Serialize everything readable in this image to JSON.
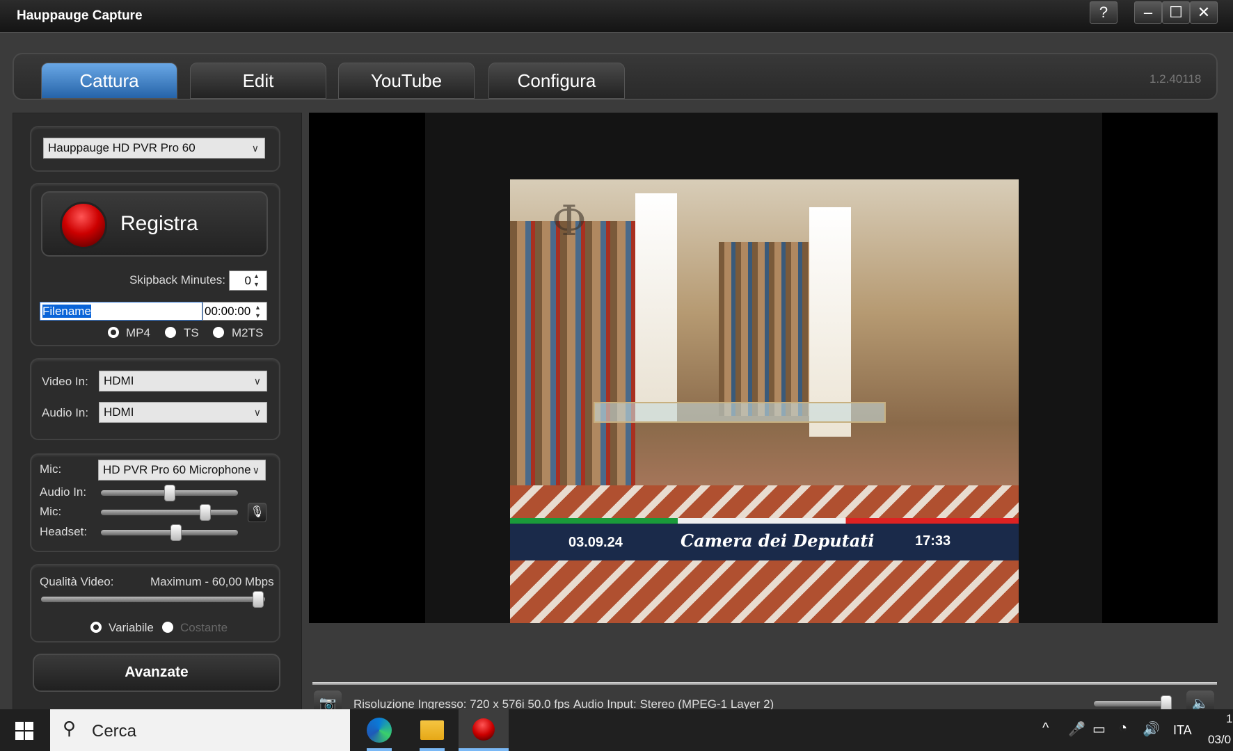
{
  "window": {
    "title": "Hauppauge Capture",
    "help": "?",
    "minimize": "–",
    "maximize": "☐",
    "close": "✕"
  },
  "tabs": [
    {
      "label": "Cattura"
    },
    {
      "label": "Edit"
    },
    {
      "label": "YouTube"
    },
    {
      "label": "Configura"
    }
  ],
  "version": "1.2.40118",
  "device": {
    "selected": "Hauppauge HD PVR Pro 60"
  },
  "record": {
    "label": "Registra",
    "skipback_label": "Skipback Minutes:",
    "skipback_value": "0",
    "filename": "Filename",
    "time": "00:00:00",
    "formats": [
      "MP4",
      "TS",
      "M2TS"
    ],
    "selected_format": "MP4"
  },
  "inputs": {
    "video_label": "Video In:",
    "video_value": "HDMI",
    "audio_label": "Audio In:",
    "audio_value": "HDMI"
  },
  "audio": {
    "mic_label": "Mic:",
    "mic_value": "HD PVR Pro 60 Microphone",
    "sliders": [
      {
        "label": "Audio In:",
        "value": 0.5
      },
      {
        "label": "Mic:",
        "value": 0.76
      },
      {
        "label": "Headset:",
        "value": 0.55
      }
    ]
  },
  "quality": {
    "label": "Qualità Video:",
    "value": "Maximum - 60,00 Mbps",
    "level": 1.0,
    "modes": [
      "Variabile",
      "Costante"
    ],
    "selected_mode": "Variabile"
  },
  "advanced_label": "Avanzate",
  "overlay": {
    "date": "03.09.24",
    "channel": "Camera dei Deputati",
    "time": "17:33"
  },
  "status": {
    "resolution": "Risoluzione Ingresso: 720 x 576i 50.0 fps",
    "audio": "Audio Input: Stereo (MPEG-1 Layer 2)",
    "volume": 0.95
  },
  "taskbar": {
    "search": "Cerca",
    "lang": "ITA",
    "clock_time": "1",
    "clock_date": "03/0"
  }
}
